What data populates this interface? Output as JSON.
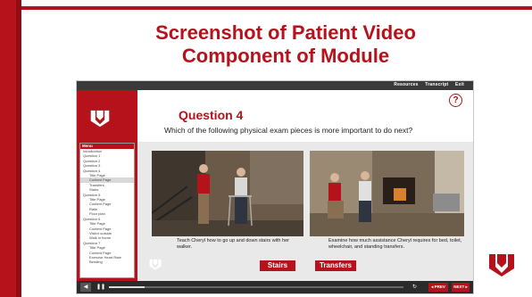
{
  "slide": {
    "title_line1": "Screenshot of Patient Video",
    "title_line2": "Component of Module",
    "brand_color": "#b5121b"
  },
  "module": {
    "top_links": [
      "Resources",
      "Transcript",
      "Exit"
    ],
    "help_label": "?",
    "question_title": "Question 4",
    "question_text": "Which of the following physical exam pieces is more important to do next?",
    "menu_header": "Menu",
    "menu_items": [
      {
        "label": "Introduction",
        "level": "top",
        "selected": false
      },
      {
        "label": "Question 1",
        "level": "top",
        "selected": false
      },
      {
        "label": "Question 2",
        "level": "top",
        "selected": false
      },
      {
        "label": "Question 3",
        "level": "top",
        "selected": false
      },
      {
        "label": "Question 4",
        "level": "top",
        "selected": false
      },
      {
        "label": "Title Page",
        "level": "indent",
        "selected": false
      },
      {
        "label": "Content Page",
        "level": "indent",
        "selected": true
      },
      {
        "label": "Transfers",
        "level": "indent",
        "selected": false
      },
      {
        "label": "Stairs",
        "level": "indent",
        "selected": false
      },
      {
        "label": "Question 5",
        "level": "top",
        "selected": false
      },
      {
        "label": "Title Page",
        "level": "indent",
        "selected": false
      },
      {
        "label": "Content Page",
        "level": "indent",
        "selected": false
      },
      {
        "label": "Rails",
        "level": "indent",
        "selected": false
      },
      {
        "label": "Floor plan",
        "level": "indent",
        "selected": false
      },
      {
        "label": "Question 6",
        "level": "top",
        "selected": false
      },
      {
        "label": "Title Page",
        "level": "indent",
        "selected": false
      },
      {
        "label": "Content Page",
        "level": "indent",
        "selected": false
      },
      {
        "label": "Visitor outside",
        "level": "indent",
        "selected": false
      },
      {
        "label": "Walk in home",
        "level": "indent",
        "selected": false
      },
      {
        "label": "Question 7",
        "level": "top",
        "selected": false
      },
      {
        "label": "Title Page",
        "level": "indent",
        "selected": false
      },
      {
        "label": "Content Page",
        "level": "indent",
        "selected": false
      },
      {
        "label": "Exercise Heart Rate",
        "level": "indent",
        "selected": false
      },
      {
        "label": "Bending",
        "level": "indent",
        "selected": false
      }
    ],
    "option1_caption": "Teach Cheryl how to go up and down stairs with her walker.",
    "option2_caption": "Examine how much assistance Cheryl requires for bed, toilet, wheelchair, and standing transfers.",
    "choice1": "Stairs",
    "choice2": "Transfers",
    "prev_label": "◂ PREV",
    "next_label": "NEXT ▸",
    "playback_progress": 0.12
  }
}
